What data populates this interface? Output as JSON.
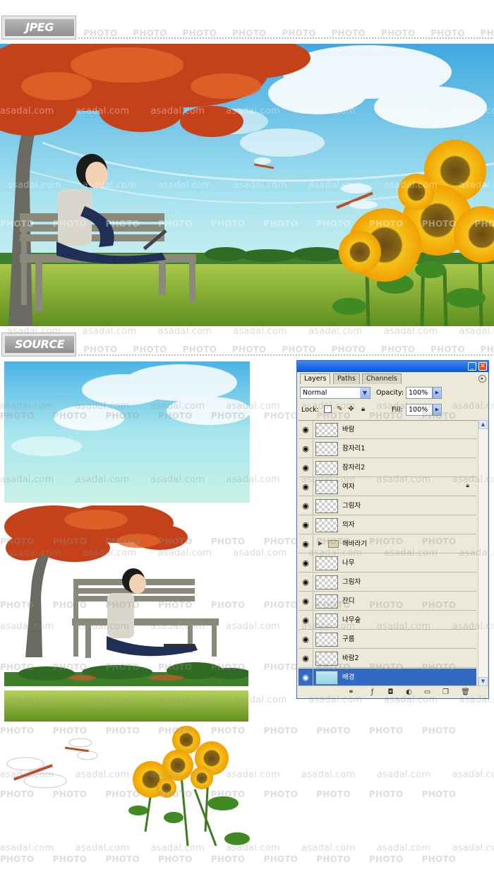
{
  "labels": {
    "jpeg": "JPEG",
    "source": "SOURCE"
  },
  "watermarks": {
    "photo": "PHOTO",
    "site": "asadal.com"
  },
  "layers_panel": {
    "tabs": [
      "Layers",
      "Paths",
      "Channels"
    ],
    "blend_mode": "Normal",
    "opacity_label": "Opacity:",
    "opacity_value": "100%",
    "lock_label": "Lock:",
    "fill_label": "Fill:",
    "fill_value": "100%",
    "layers": [
      {
        "name": "바람",
        "visible": true,
        "thumb": "checker"
      },
      {
        "name": "잠자리1",
        "visible": true,
        "thumb": "checker"
      },
      {
        "name": "잠자리2",
        "visible": true,
        "thumb": "checker"
      },
      {
        "name": "여자",
        "visible": true,
        "thumb": "checker",
        "locked": true
      },
      {
        "name": "그림자",
        "visible": true,
        "thumb": "checker"
      },
      {
        "name": "의자",
        "visible": true,
        "thumb": "checker"
      },
      {
        "name": "해바라기",
        "visible": true,
        "thumb": "folder"
      },
      {
        "name": "나무",
        "visible": true,
        "thumb": "checker"
      },
      {
        "name": "그림자",
        "visible": true,
        "thumb": "checker"
      },
      {
        "name": "잔디",
        "visible": true,
        "thumb": "checker"
      },
      {
        "name": "나무숲",
        "visible": true,
        "thumb": "checker"
      },
      {
        "name": "구름",
        "visible": true,
        "thumb": "checker"
      },
      {
        "name": "바람2",
        "visible": true,
        "thumb": "checker"
      },
      {
        "name": "배경",
        "visible": true,
        "thumb": "sky",
        "selected": true
      }
    ]
  },
  "colors": {
    "selection": "#316ac5",
    "panel_bg": "#ece9d8",
    "title_bar": "#0a55d8"
  }
}
